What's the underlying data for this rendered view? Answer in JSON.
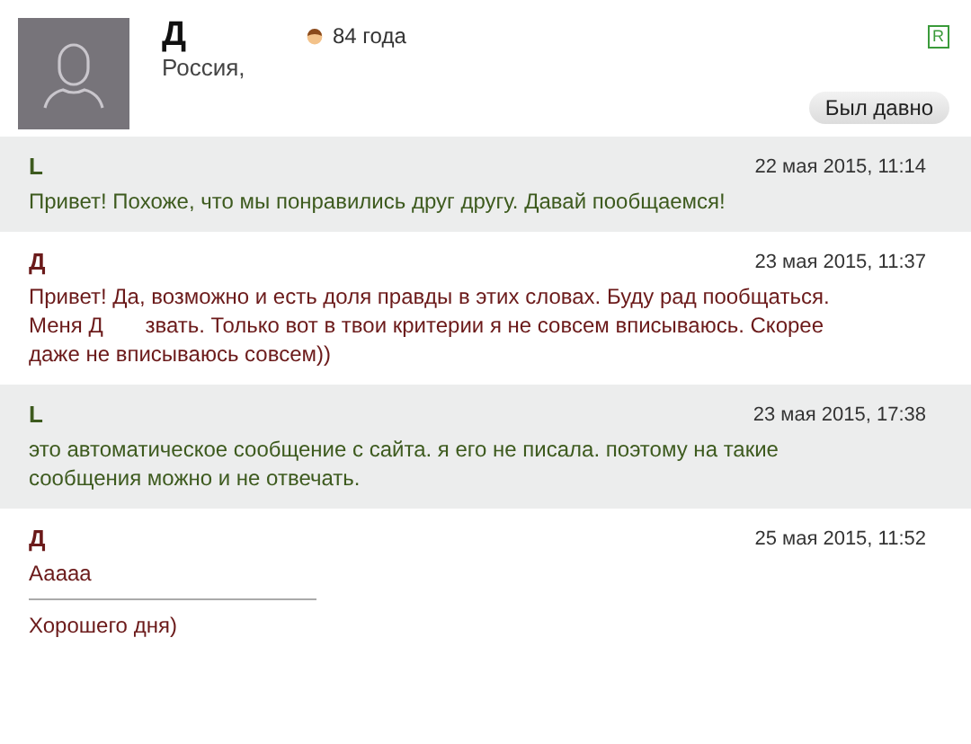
{
  "profile": {
    "name": "Д",
    "age": "84 года",
    "location": "Россия,",
    "badge": "R",
    "status": "Был давно"
  },
  "messages": [
    {
      "kind": "incoming",
      "author": "L",
      "date": "22 мая 2015, 11:14",
      "paragraphs": [
        "Привет! Похоже, что мы понравились друг другу. Давай пообщаемся!"
      ]
    },
    {
      "kind": "outgoing",
      "author": "Д",
      "date": "23 мая 2015, 11:37",
      "paragraphs": [
        "Привет! Да, возможно и есть доля правды в этих словах. Буду рад пообщаться. Меня Д       звать. Только вот в твои критерии я не совсем вписываюсь. Скорее даже не вписываюсь совсем))"
      ]
    },
    {
      "kind": "incoming",
      "author": "L",
      "date": "23 мая 2015, 17:38",
      "paragraphs": [
        "это автоматическое сообщение с сайта. я его не писала. поэтому на такие сообщения можно и не отвечать."
      ]
    },
    {
      "kind": "outgoing",
      "author": "Д",
      "date": "25 мая 2015, 11:52",
      "paragraphs": [
        "Ааааа",
        "Хорошего дня)"
      ]
    }
  ]
}
